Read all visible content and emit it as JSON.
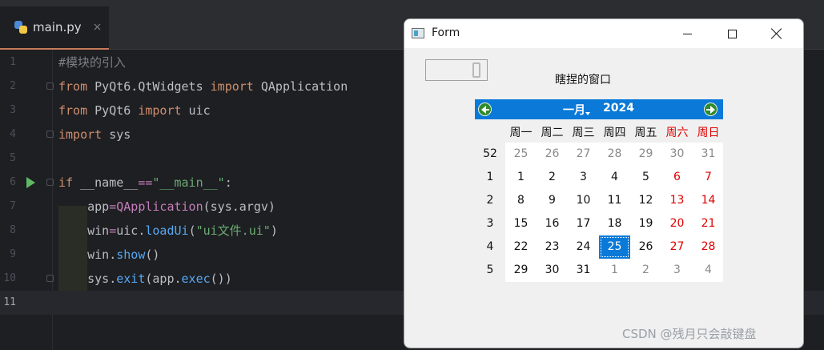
{
  "editor": {
    "tab_label": "main.py",
    "tab_close": "×",
    "line_numbers": [
      "1",
      "2",
      "3",
      "4",
      "5",
      "6",
      "7",
      "8",
      "9",
      "10",
      "11"
    ],
    "lines": [
      [
        {
          "t": "#模块的引入",
          "c": "cm"
        }
      ],
      [
        {
          "t": "from",
          "c": "kw"
        },
        {
          "t": " PyQt6.QtWidgets ",
          "c": ""
        },
        {
          "t": "import",
          "c": "kw"
        },
        {
          "t": " QApplication",
          "c": ""
        }
      ],
      [
        {
          "t": "from",
          "c": "kw"
        },
        {
          "t": " PyQt6 ",
          "c": ""
        },
        {
          "t": "import",
          "c": "kw"
        },
        {
          "t": " uic",
          "c": ""
        }
      ],
      [
        {
          "t": "import",
          "c": "kw"
        },
        {
          "t": " sys",
          "c": ""
        }
      ],
      [],
      [
        {
          "t": "if",
          "c": "kw"
        },
        {
          "t": " __name__",
          "c": ""
        },
        {
          "t": "==",
          "c": "mag"
        },
        {
          "t": "\"__main__\"",
          "c": "str"
        },
        {
          "t": ":",
          "c": ""
        }
      ],
      [
        {
          "t": "    app",
          "c": ""
        },
        {
          "t": "=",
          "c": "mag"
        },
        {
          "t": "QApplication",
          "c": "mag"
        },
        {
          "t": "(sys.argv)",
          "c": ""
        }
      ],
      [
        {
          "t": "    win",
          "c": ""
        },
        {
          "t": "=",
          "c": "mag"
        },
        {
          "t": "uic.",
          "c": ""
        },
        {
          "t": "loadUi",
          "c": "fn"
        },
        {
          "t": "(",
          "c": ""
        },
        {
          "t": "\"ui文件.ui\"",
          "c": "str"
        },
        {
          "t": ")",
          "c": ""
        }
      ],
      [
        {
          "t": "    win.",
          "c": ""
        },
        {
          "t": "show",
          "c": "fn"
        },
        {
          "t": "()",
          "c": ""
        }
      ],
      [
        {
          "t": "    sys.",
          "c": ""
        },
        {
          "t": "exit",
          "c": "fn"
        },
        {
          "t": "(app.",
          "c": ""
        },
        {
          "t": "exec",
          "c": "fn"
        },
        {
          "t": "())",
          "c": ""
        }
      ],
      []
    ]
  },
  "form": {
    "title": "Form",
    "label": "瞎捏的窗口",
    "calendar": {
      "month": "一月",
      "year": "2024",
      "weekdays": [
        "周一",
        "周二",
        "周三",
        "周四",
        "周五",
        "周六",
        "周日"
      ],
      "weeks": [
        {
          "num": "52",
          "days": [
            "25",
            "26",
            "27",
            "28",
            "29",
            "30",
            "31"
          ],
          "out": [
            true,
            true,
            true,
            true,
            true,
            true,
            true
          ]
        },
        {
          "num": "1",
          "days": [
            "1",
            "2",
            "3",
            "4",
            "5",
            "6",
            "7"
          ],
          "out": [
            false,
            false,
            false,
            false,
            false,
            false,
            false
          ]
        },
        {
          "num": "2",
          "days": [
            "8",
            "9",
            "10",
            "11",
            "12",
            "13",
            "14"
          ],
          "out": [
            false,
            false,
            false,
            false,
            false,
            false,
            false
          ]
        },
        {
          "num": "3",
          "days": [
            "15",
            "16",
            "17",
            "18",
            "19",
            "20",
            "21"
          ],
          "out": [
            false,
            false,
            false,
            false,
            false,
            false,
            false
          ]
        },
        {
          "num": "4",
          "days": [
            "22",
            "23",
            "24",
            "25",
            "26",
            "27",
            "28"
          ],
          "out": [
            false,
            false,
            false,
            false,
            false,
            false,
            false
          ]
        },
        {
          "num": "5",
          "days": [
            "29",
            "30",
            "31",
            "1",
            "2",
            "3",
            "4"
          ],
          "out": [
            false,
            false,
            false,
            true,
            true,
            true,
            true
          ]
        }
      ],
      "selected": "25"
    }
  },
  "watermark": "CSDN @残月只会敲键盘",
  "colors": {
    "accent": "#0a79d7",
    "weekend": "#e00000",
    "keyword": "#cf8e6d",
    "string": "#6aab73"
  }
}
